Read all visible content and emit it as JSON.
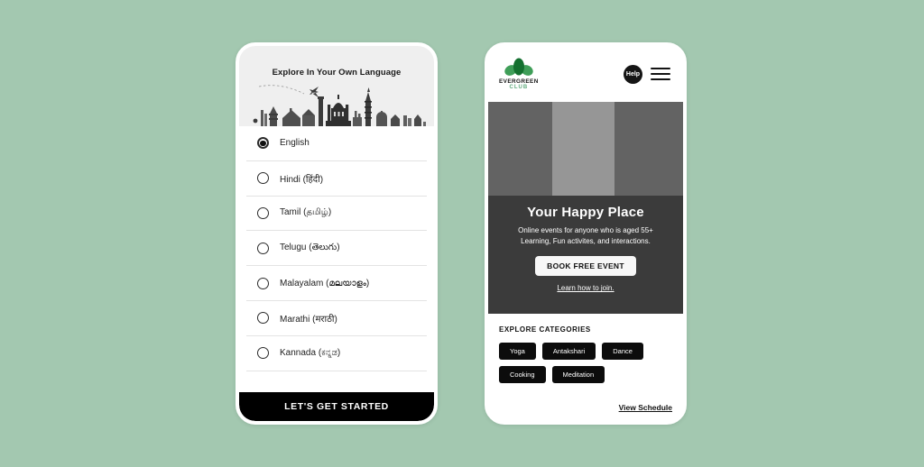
{
  "canvas": {
    "background_color": "#a3c8b0"
  },
  "language_screen": {
    "hero_title": "Explore In Your Own Language",
    "illustration": "india-skyline-illustration",
    "languages": [
      {
        "label": "English",
        "selected": true
      },
      {
        "label": "Hindi (हिंदी)",
        "selected": false
      },
      {
        "label": "Tamil (தமிழ்)",
        "selected": false
      },
      {
        "label": "Telugu (తెలుగు)",
        "selected": false
      },
      {
        "label": "Malayalam (മലയാളം)",
        "selected": false
      },
      {
        "label": "Marathi (मराठी)",
        "selected": false
      },
      {
        "label": "Kannada (ಕನ್ನಡ)",
        "selected": false
      }
    ],
    "cta_label": "LET'S GET STARTED"
  },
  "home_screen": {
    "brand": {
      "name": "EVERGREEN",
      "sub": "CLUB",
      "accent_color": "#5fa97c"
    },
    "header": {
      "help_label": "Help",
      "menu_icon": "hamburger-menu-icon"
    },
    "hero": {
      "title": "Your Happy Place",
      "subtitle_line1": "Online events for anyone who is aged 55+",
      "subtitle_line2": "Learning, Fun activites, and interactions.",
      "button_label": "BOOK FREE EVENT",
      "link_label": "Learn how to join.",
      "band_colors": [
        "#636363",
        "#969696",
        "#636363"
      ],
      "overlay_color": "#3b3b3b"
    },
    "categories": {
      "title": "EXPLORE CATEGORIES",
      "chips": [
        "Yoga",
        "Antakshari",
        "Dance",
        "Cooking",
        "Meditation"
      ],
      "schedule_link": "View Schedule"
    }
  }
}
